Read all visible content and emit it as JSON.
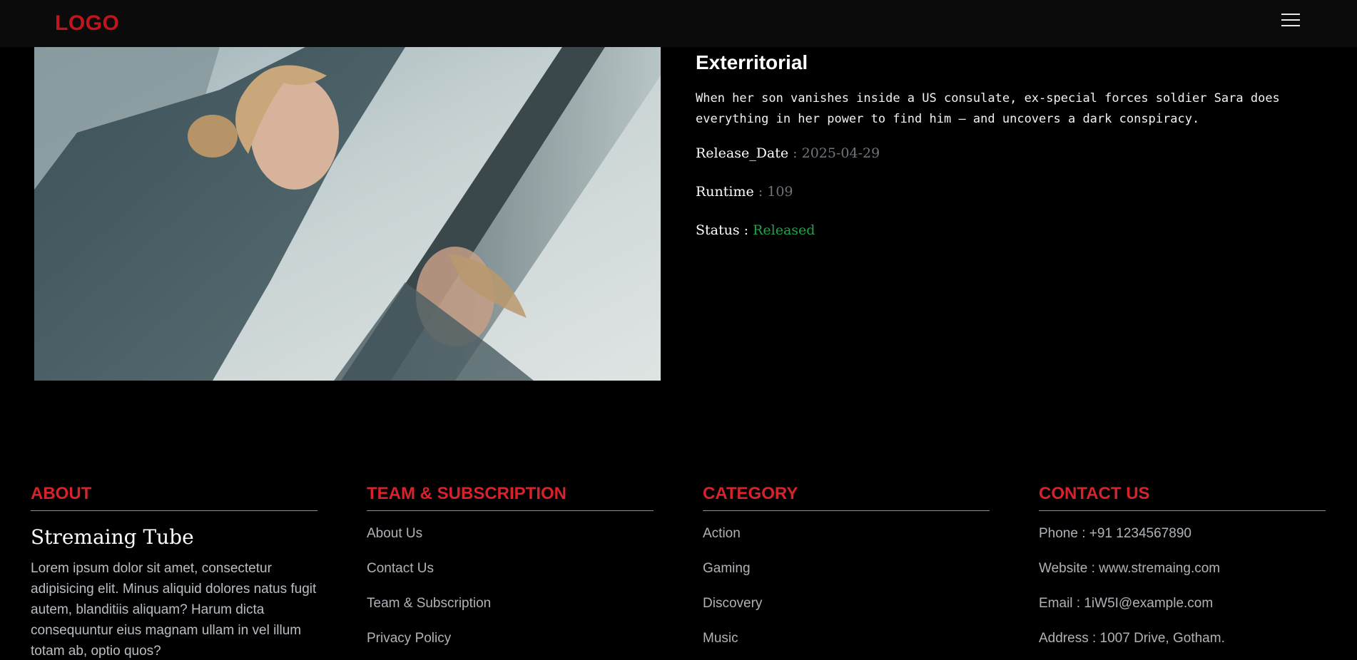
{
  "navbar": {
    "logo": "LOGO",
    "menu_icon": "hamburger-menu-icon"
  },
  "movie": {
    "title": "Exterritorial",
    "overview": "When her son vanishes inside a US consulate, ex-special forces soldier Sara does everything in her power to find him — and uncovers a dark conspiracy.",
    "release_label": "Release_Date",
    "release_value": "2025-04-29",
    "runtime_label": "Runtime",
    "runtime_value": "109",
    "status_label": "Status",
    "status_value": "Released",
    "separator": " : "
  },
  "footer": {
    "about": {
      "heading": "ABOUT",
      "brand": "Stremaing Tube",
      "text": "Lorem ipsum dolor sit amet, consectetur adipisicing elit. Minus aliquid dolores natus fugit autem, blanditiis aliquam? Harum dicta consequuntur eius magnam ullam in vel illum totam ab, optio quos?"
    },
    "team": {
      "heading": "TEAM & SUBSCRIPTION",
      "links": [
        "About Us",
        "Contact Us",
        "Team & Subscription",
        "Privacy Policy"
      ]
    },
    "category": {
      "heading": "CATEGORY",
      "links": [
        "Action",
        "Gaming",
        "Discovery",
        "Music"
      ]
    },
    "contact": {
      "heading": "CONTACT US",
      "items": [
        "Phone : +91 1234567890",
        "Website : www.stremaing.com",
        "Email : 1iW5I@example.com",
        "Address : 1007 Drive, Gotham."
      ]
    }
  },
  "colors": {
    "brand_red": "#c0151d",
    "heading_red": "#d8222a",
    "status_green": "#1fa34a",
    "muted_gray": "#6f7479"
  }
}
